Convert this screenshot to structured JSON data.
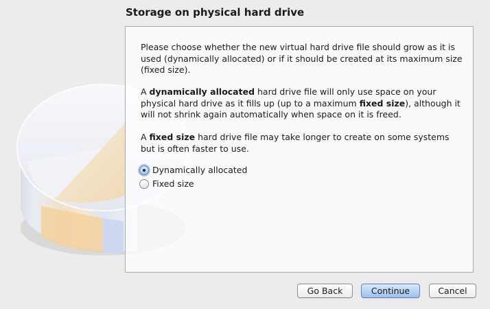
{
  "wizard": {
    "title": "Storage on physical hard drive",
    "para1": "Please choose whether the new virtual hard drive file should grow as it is used (dynamically allocated) or if it should be created at its maximum size (fixed size).",
    "para2": {
      "t1": "A ",
      "b1": "dynamically allocated",
      "t2": " hard drive file will only use space on your physical hard drive as it fills up (up to a maximum ",
      "b2": "fixed size",
      "t3": "), although it will not shrink again automatically when space on it is freed."
    },
    "para3": {
      "t1": "A ",
      "b1": "fixed size",
      "t2": " hard drive file may take longer to create on some systems but is often faster to use."
    },
    "options": [
      {
        "label": "Dynamically allocated",
        "selected": true
      },
      {
        "label": "Fixed size",
        "selected": false
      }
    ]
  },
  "buttons": {
    "back": "Go Back",
    "continue": "Continue",
    "cancel": "Cancel"
  }
}
